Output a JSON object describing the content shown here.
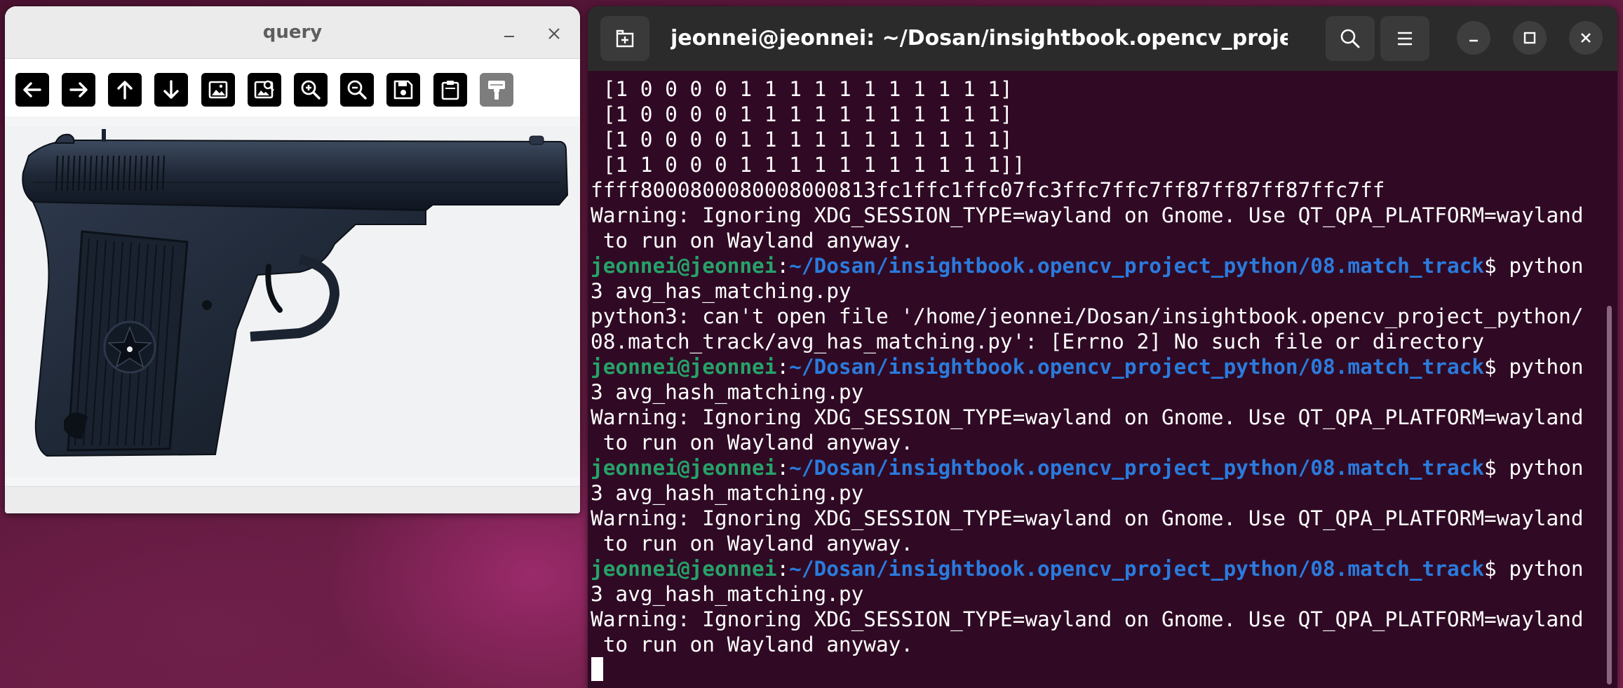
{
  "query_window": {
    "title": "query",
    "controls": {
      "minimize": "minimize-icon",
      "close": "close-icon"
    },
    "toolbar": [
      {
        "name": "pan-left-button",
        "icon": "arrow-left-icon"
      },
      {
        "name": "pan-right-button",
        "icon": "arrow-right-icon"
      },
      {
        "name": "pan-up-button",
        "icon": "arrow-up-icon"
      },
      {
        "name": "pan-down-button",
        "icon": "arrow-down-icon"
      },
      {
        "name": "zoom-original-button",
        "icon": "image-icon"
      },
      {
        "name": "zoom-fit-button",
        "icon": "image-search-icon"
      },
      {
        "name": "zoom-in-button",
        "icon": "zoom-in-icon"
      },
      {
        "name": "zoom-out-button",
        "icon": "zoom-out-icon"
      },
      {
        "name": "save-button",
        "icon": "save-icon"
      },
      {
        "name": "properties-button",
        "icon": "clipboard-icon"
      },
      {
        "name": "expand-button",
        "icon": "paint-roller-icon",
        "disabled": true
      }
    ],
    "image": "pistol-illustration"
  },
  "terminal": {
    "title": "jeonnei@jeonnei: ~/Dosan/insightbook.opencv_project_pyth...",
    "header_icons": {
      "new_tab": "new-tab-icon",
      "search": "search-icon",
      "menu": "hamburger-menu-icon"
    },
    "window_controls": {
      "minimize": "minimize-icon",
      "maximize": "maximize-icon",
      "close": "close-icon"
    },
    "prompt": {
      "user": "jeonnei@jeonnei",
      "path": "~/Dosan/insightbook.opencv_project_python/08.match_track",
      "symbol": "$"
    },
    "lines": [
      {
        "type": "text",
        "text": " [1 0 0 0 0 1 1 1 1 1 1 1 1 1 1 1]"
      },
      {
        "type": "text",
        "text": " [1 0 0 0 0 1 1 1 1 1 1 1 1 1 1 1]"
      },
      {
        "type": "text",
        "text": " [1 0 0 0 0 1 1 1 1 1 1 1 1 1 1 1]"
      },
      {
        "type": "text",
        "text": " [1 1 0 0 0 1 1 1 1 1 1 1 1 1 1 1]]"
      },
      {
        "type": "text",
        "text": "ffff8000800080008000813fc1ffc1ffc07fc3ffc7ffc7ff87ff87ff87ffc7ff"
      },
      {
        "type": "text",
        "text": "Warning: Ignoring XDG_SESSION_TYPE=wayland on Gnome. Use QT_QPA_PLATFORM=wayland"
      },
      {
        "type": "text",
        "text": " to run on Wayland anyway."
      },
      {
        "type": "prompt",
        "text": " python"
      },
      {
        "type": "text",
        "text": "3 avg_has_matching.py"
      },
      {
        "type": "text",
        "text": "python3: can't open file '/home/jeonnei/Dosan/insightbook.opencv_project_python/"
      },
      {
        "type": "text",
        "text": "08.match_track/avg_has_matching.py': [Errno 2] No such file or directory"
      },
      {
        "type": "prompt",
        "text": " python"
      },
      {
        "type": "text",
        "text": "3 avg_hash_matching.py"
      },
      {
        "type": "text",
        "text": "Warning: Ignoring XDG_SESSION_TYPE=wayland on Gnome. Use QT_QPA_PLATFORM=wayland"
      },
      {
        "type": "text",
        "text": " to run on Wayland anyway."
      },
      {
        "type": "prompt",
        "text": " python"
      },
      {
        "type": "text",
        "text": "3 avg_hash_matching.py"
      },
      {
        "type": "text",
        "text": "Warning: Ignoring XDG_SESSION_TYPE=wayland on Gnome. Use QT_QPA_PLATFORM=wayland"
      },
      {
        "type": "text",
        "text": " to run on Wayland anyway."
      },
      {
        "type": "prompt",
        "text": " python"
      },
      {
        "type": "text",
        "text": "3 avg_hash_matching.py"
      },
      {
        "type": "text",
        "text": "Warning: Ignoring XDG_SESSION_TYPE=wayland on Gnome. Use QT_QPA_PLATFORM=wayland"
      },
      {
        "type": "text",
        "text": " to run on Wayland anyway."
      },
      {
        "type": "cursor",
        "text": ""
      }
    ],
    "colors": {
      "background": "#300a24",
      "user": "#26a269",
      "path": "#2a7bde",
      "text": "#ffffff"
    }
  }
}
